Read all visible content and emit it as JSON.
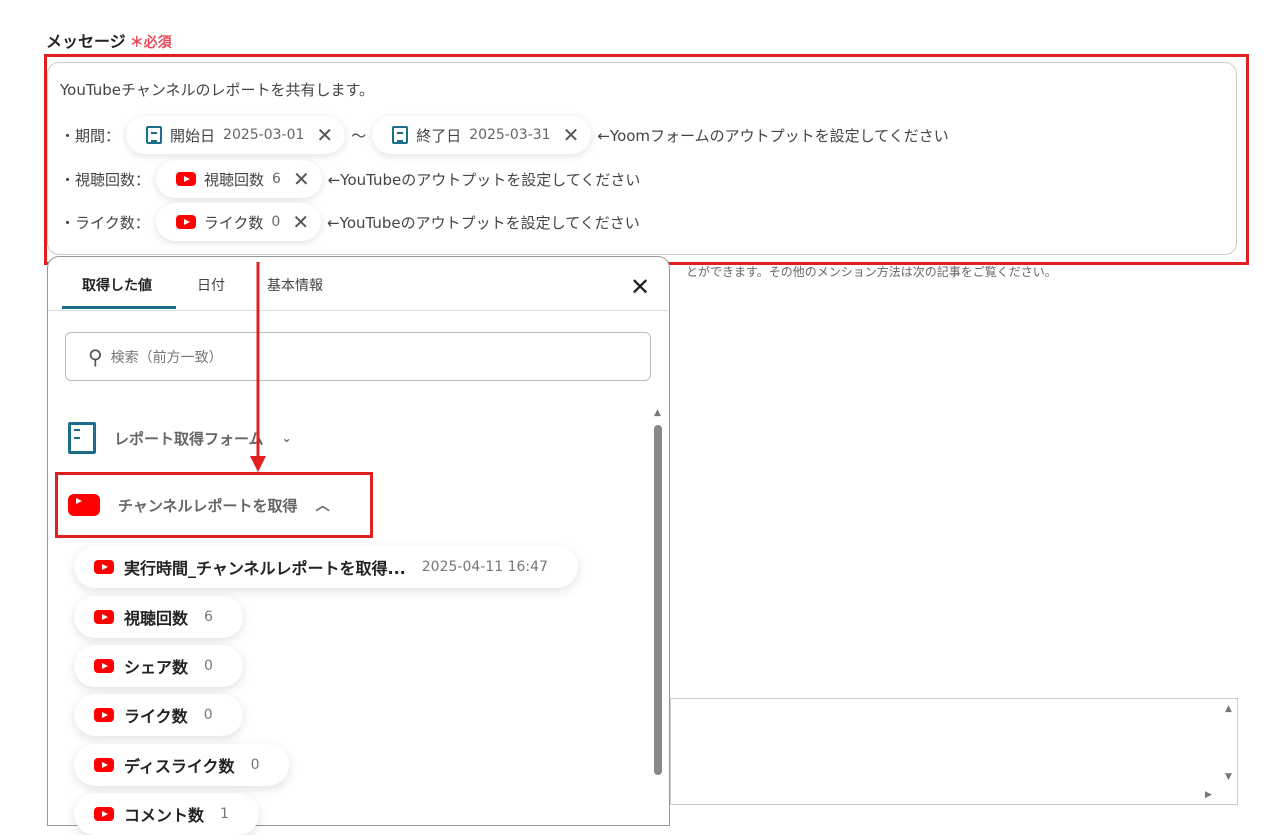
{
  "field": {
    "label": "メッセージ",
    "required": "＊必須"
  },
  "message": {
    "line1": "YouTubeチャンネルのレポートを共有します。",
    "period_label": "・期間：",
    "start": {
      "name": "開始日",
      "value": "2025-03-01"
    },
    "tilde": "〜",
    "end": {
      "name": "終了日",
      "value": "2025-03-31"
    },
    "period_note": "←Yoomフォームのアウトプットを設定してください",
    "views_label": "・視聴回数：",
    "views": {
      "name": "視聴回数",
      "value": "6"
    },
    "views_note": "←YouTubeのアウトプットを設定してください",
    "likes_label": "・ライク数：",
    "likes": {
      "name": "ライク数",
      "value": "0"
    },
    "likes_note": "←YouTubeのアウトプットを設定してください"
  },
  "hint": "とができます。その他のメンション方法は次の記事をご覧ください。",
  "panel": {
    "tabs": [
      "取得した値",
      "日付",
      "基本情報"
    ],
    "search_placeholder": "検索（前方一致）",
    "sections": [
      {
        "label": "レポート取得フォーム"
      },
      {
        "label": "チャンネルレポートを取得"
      }
    ],
    "items": [
      {
        "name": "実行時間_チャンネルレポートを取得...",
        "value": "2025-04-11 16:47"
      },
      {
        "name": "視聴回数",
        "value": "6"
      },
      {
        "name": "シェア数",
        "value": "0"
      },
      {
        "name": "ライク数",
        "value": "0"
      },
      {
        "name": "ディスライク数",
        "value": "0"
      },
      {
        "name": "コメント数",
        "value": "1"
      }
    ]
  },
  "colors": {
    "highlight": "#e02020",
    "youtube": "#ff0000",
    "accent": "#1a6e8a"
  }
}
